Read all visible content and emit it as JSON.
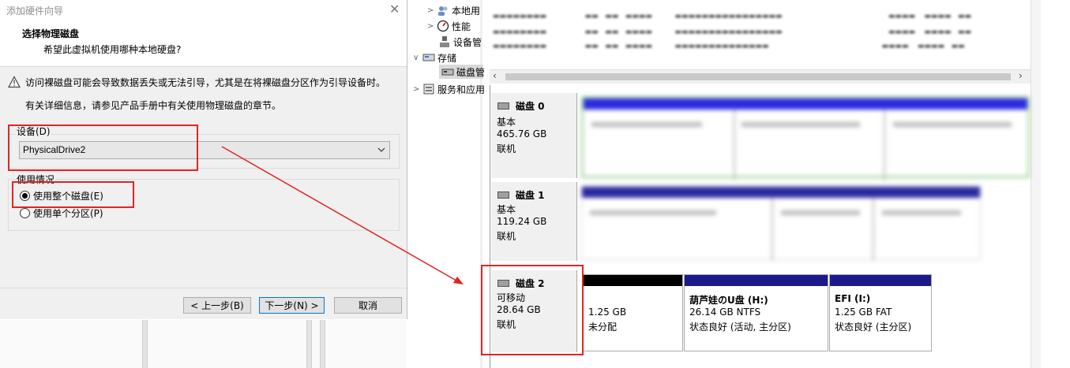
{
  "wizard": {
    "title": "添加硬件向导",
    "heading": "选择物理磁盘",
    "subheading": "希望此虚拟机使用哪种本地硬盘?",
    "warning": "访问裸磁盘可能会导致数据丢失或无法引导，尤其是在将裸磁盘分区作为引导设备时。",
    "info": "有关详细信息，请参见产品手册中有关使用物理磁盘的章节。",
    "device_label": "设备(D)",
    "device_value": "PhysicalDrive2",
    "usage_label": "使用情况",
    "radio_whole": "使用整个磁盘(E)",
    "radio_partition": "使用单个分区(P)",
    "btn_back": "< 上一步(B)",
    "btn_next": "下一步(N) >",
    "btn_cancel": "取消"
  },
  "tree": {
    "local_users": "本地用",
    "performance": "性能",
    "device_manager": "设备管",
    "storage": "存储",
    "disk_management": "磁盘管",
    "services": "服务和应用"
  },
  "disks": [
    {
      "name": "磁盘 0",
      "type": "基本",
      "size": "465.76 GB",
      "status": "联机"
    },
    {
      "name": "磁盘 1",
      "type": "基本",
      "size": "119.24 GB",
      "status": "联机"
    },
    {
      "name": "磁盘 2",
      "type": "可移动",
      "size": "28.64 GB",
      "status": "联机"
    }
  ],
  "disk2_partitions": [
    {
      "title": "",
      "size": "1.25 GB",
      "desc": "未分配"
    },
    {
      "title": "葫芦娃のU盘  (H:)",
      "size": "26.14 GB NTFS",
      "desc": "状态良好 (活动, 主分区)"
    },
    {
      "title": "EFI  (I:)",
      "size": "1.25 GB FAT",
      "desc": "状态良好 (主分区)"
    }
  ],
  "colors": {
    "annotation": "#e22424",
    "primary_bar": "#1a1a8c",
    "unallocated_bar": "#000000",
    "disk0_bar": "#2a2adf"
  }
}
